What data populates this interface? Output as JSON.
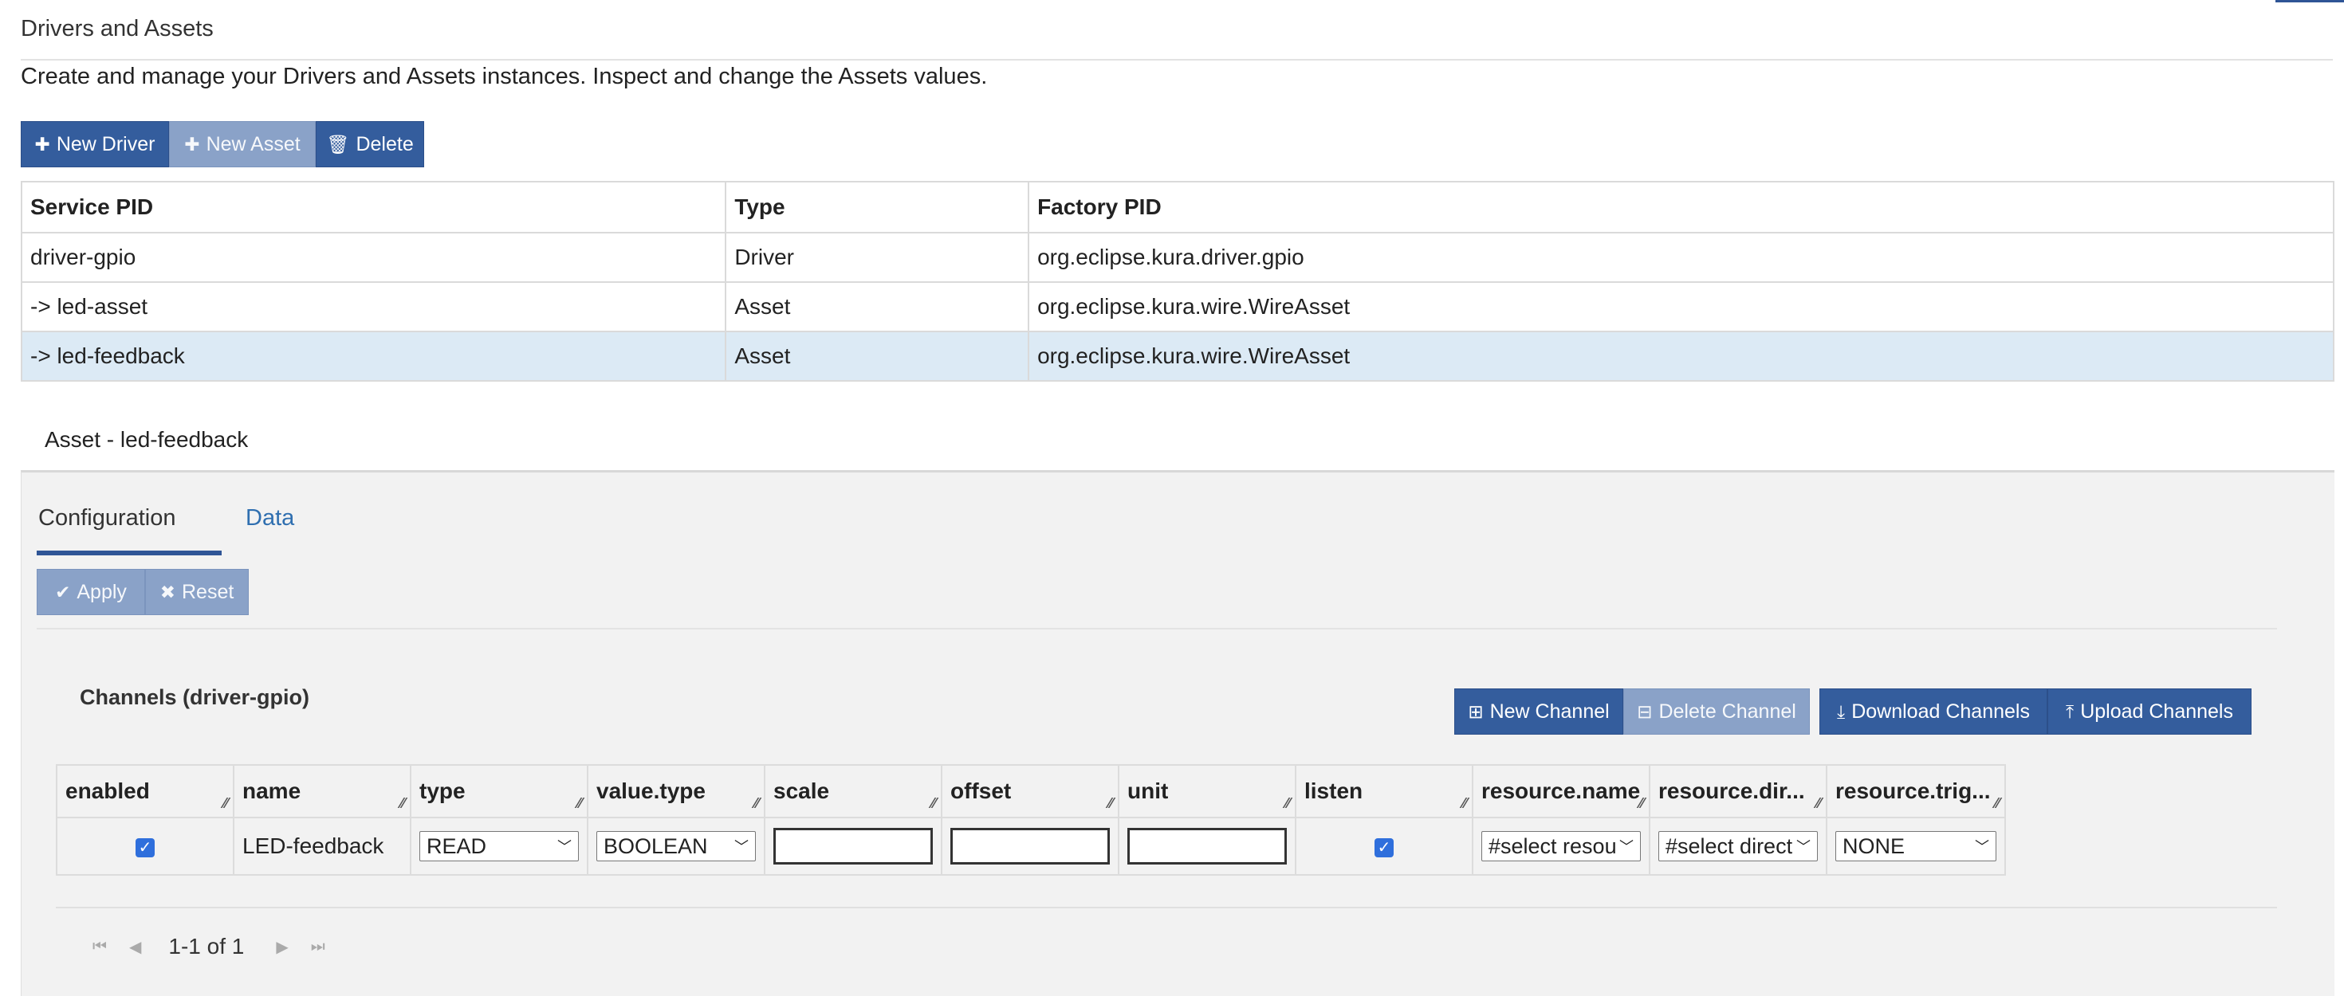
{
  "page": {
    "title": "Drivers and Assets",
    "subtitle": "Create and manage your Drivers and Assets instances. Inspect and change the Assets values."
  },
  "toolbar": {
    "new_driver": "New Driver",
    "new_asset": "New Asset",
    "delete": "Delete"
  },
  "services_table": {
    "headers": [
      "Service PID",
      "Type",
      "Factory PID"
    ],
    "rows": [
      {
        "pid": "driver-gpio",
        "type": "Driver",
        "factory": "org.eclipse.kura.driver.gpio"
      },
      {
        "pid": "-> led-asset",
        "type": "Asset",
        "factory": "org.eclipse.kura.wire.WireAsset"
      },
      {
        "pid": "-> led-feedback",
        "type": "Asset",
        "factory": "org.eclipse.kura.wire.WireAsset"
      }
    ]
  },
  "asset_panel": {
    "title": "Asset - led-feedback",
    "tabs": [
      "Configuration",
      "Data"
    ],
    "apply": "Apply",
    "reset": "Reset",
    "channels_title": "Channels (driver-gpio)",
    "new_channel": "New Channel",
    "delete_channel": "Delete Channel",
    "download_channels": "Download Channels",
    "upload_channels": "Upload Channels"
  },
  "channels_table": {
    "headers": [
      "enabled",
      "name",
      "type",
      "value.type",
      "scale",
      "offset",
      "unit",
      "listen",
      "resource.name",
      "resource.dir...",
      "resource.trig..."
    ],
    "row": {
      "name": "LED-feedback",
      "type": "READ",
      "value_type": "BOOLEAN",
      "resource_name": "#select resource",
      "resource_dir": "#select direction",
      "resource_trig": "NONE"
    }
  },
  "pager": {
    "label": "1-1 of 1"
  },
  "icons": {
    "plus": "plus-icon",
    "trash": "trash-icon",
    "check": "check-icon",
    "times": "times-icon",
    "download": "download-icon",
    "upload": "upload-icon"
  },
  "colors": {
    "primary": "#345d9d",
    "disabled": "#8aa2c8",
    "selected_row": "#dceaf5",
    "link": "#2f6fb0"
  }
}
